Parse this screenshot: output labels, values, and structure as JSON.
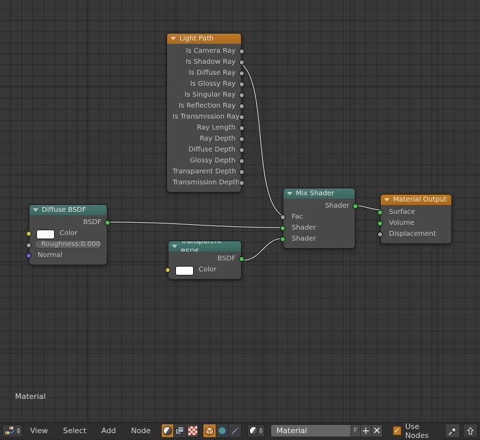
{
  "editor": {
    "canvas_label": "Material",
    "background_color": "#373737"
  },
  "nodes": [
    {
      "id": "light-path",
      "title": "Light Path",
      "header_color": "#b8721f",
      "outputs": [
        "Is Camera Ray",
        "Is Shadow Ray",
        "Is Diffuse Ray",
        "Is Glossy Ray",
        "Is Singular Ray",
        "Is Reflection Ray",
        "Is Transmission Ray",
        "Ray Length",
        "Ray Depth",
        "Diffuse Depth",
        "Glossy Depth",
        "Transparent Depth",
        "Transmission Depth"
      ],
      "inputs": []
    },
    {
      "id": "diffuse-bsdf",
      "title": "Diffuse BSDF",
      "header_color": "#3f7069",
      "outputs": [
        "BSDF"
      ],
      "inputs": [
        "Color",
        "Roughness",
        "Normal"
      ],
      "roughness_label": "Roughness:",
      "roughness_value": "0.000",
      "color_swatch": "#fdfdfd"
    },
    {
      "id": "transparent-bsdf",
      "title": "Transparent BSDF",
      "header_color": "#3f7069",
      "outputs": [
        "BSDF"
      ],
      "inputs": [
        "Color"
      ],
      "color_swatch": "#fdfdfd"
    },
    {
      "id": "mix-shader",
      "title": "Mix Shader",
      "header_color": "#3f7069",
      "outputs": [
        "Shader"
      ],
      "inputs": [
        "Fac",
        "Shader",
        "Shader"
      ]
    },
    {
      "id": "material-output",
      "title": "Material Output",
      "header_color": "#b8721f",
      "outputs": [],
      "inputs": [
        "Surface",
        "Volume",
        "Displacement"
      ]
    }
  ],
  "toolbar": {
    "editor_type_icon": "node-editor-icon",
    "menus": [
      "View",
      "Select",
      "Add",
      "Node"
    ],
    "shader_type_icons": [
      "render-shading-icon",
      "texture-copy-icon",
      "checker-texture-icon"
    ],
    "context_icons": [
      "object-icon",
      "world-icon",
      "brush-icon"
    ],
    "slot_icon": "material-ball-icon",
    "material_name": "Material",
    "fake_user_label": "F",
    "new_material_label": "+",
    "unlink_material_label": "✕",
    "use_nodes_label": "Use Nodes",
    "use_nodes_checked": true,
    "pin_icon": "pin-icon",
    "pin_active": true,
    "go_parent_icon": "arrow-up-icon",
    "accent_color": "#c0761d"
  }
}
